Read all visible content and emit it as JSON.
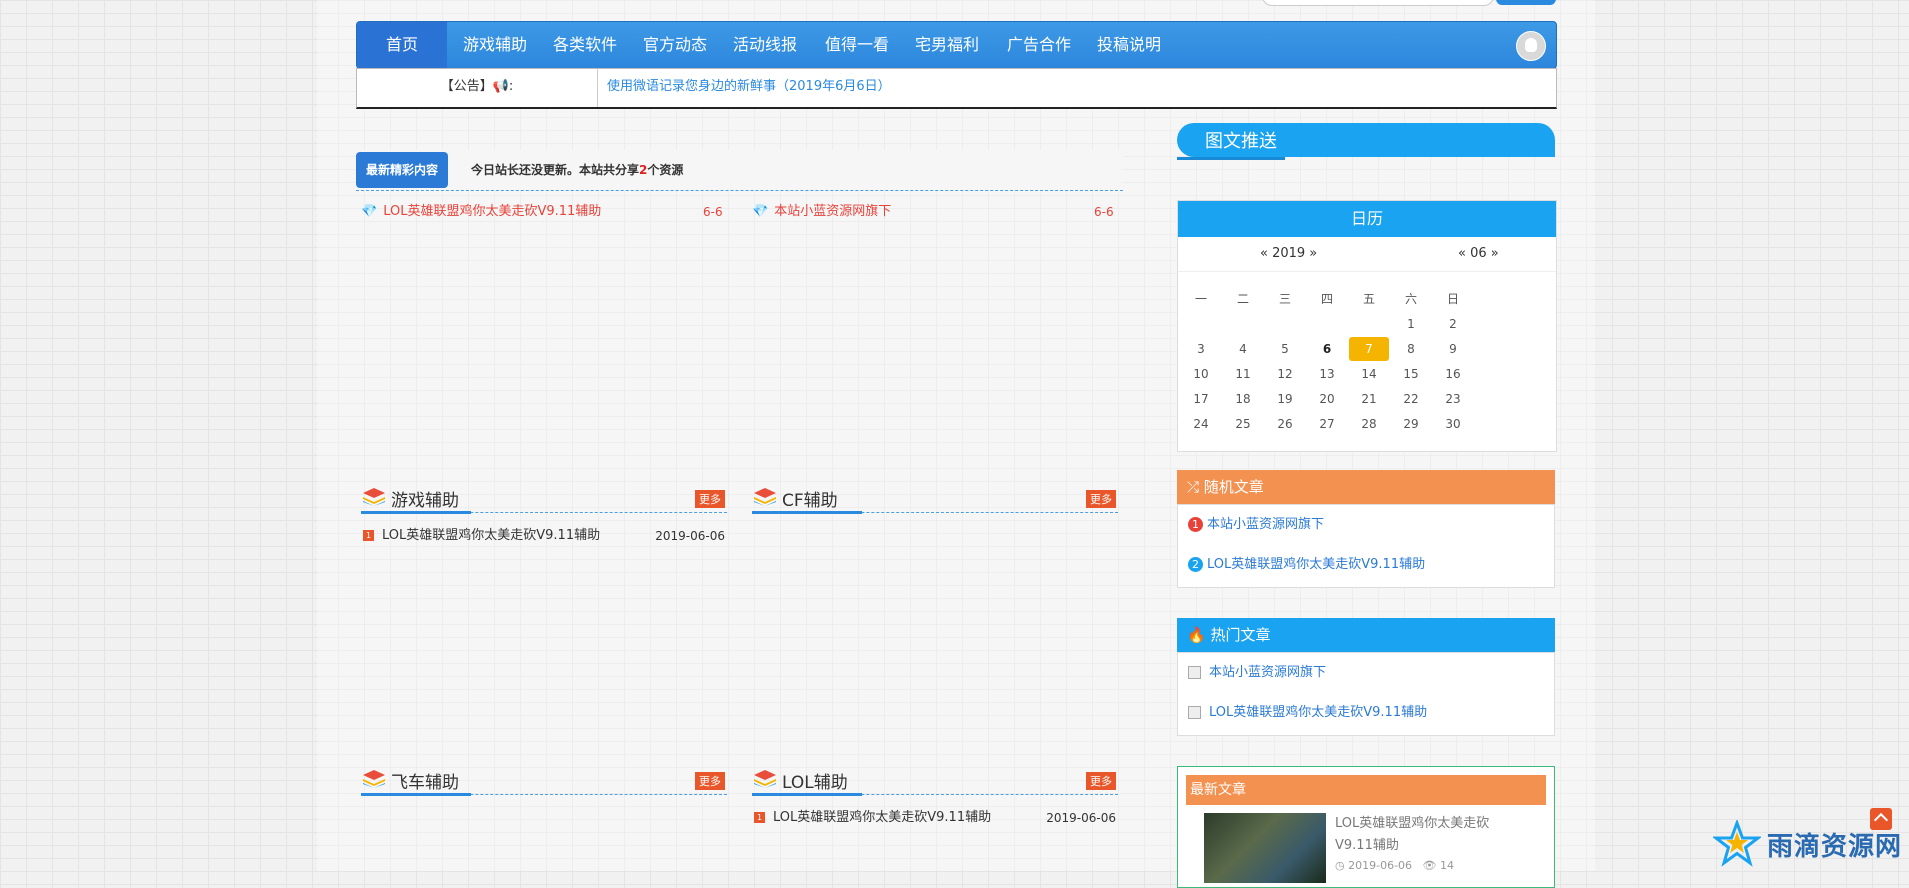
{
  "nav": {
    "items": [
      "首页",
      "游戏辅助",
      "各类软件",
      "官方动态",
      "活动线报",
      "值得一看",
      "宅男福利",
      "广告合作",
      "投稿说明"
    ]
  },
  "notice": {
    "label": "【公告】📢:",
    "text": "使用微语记录您身边的新鲜事（2019年6月6日）"
  },
  "latest": {
    "badge": "最新精彩内容",
    "info_prefix": "今日站长还没更新。本站共分享",
    "count": "2",
    "info_suffix": "个资源",
    "items": [
      {
        "title": "LOL英雄联盟鸡你太美走砍V9.11辅助",
        "date": "6-6"
      },
      {
        "title": "本站小蓝资源网旗下",
        "date": "6-6"
      }
    ]
  },
  "categories": [
    {
      "title": "游戏辅助",
      "more": "更多",
      "rows": [
        {
          "num": "1",
          "title": "LOL英雄联盟鸡你太美走砍V9.11辅助",
          "date": "2019-06-06"
        }
      ]
    },
    {
      "title": "CF辅助",
      "more": "更多",
      "rows": []
    },
    {
      "title": "飞车辅助",
      "more": "更多",
      "rows": []
    },
    {
      "title": "LOL辅助",
      "more": "更多",
      "rows": [
        {
          "num": "1",
          "title": "LOL英雄联盟鸡你太美走砍V9.11辅助",
          "date": "2019-06-06"
        }
      ]
    }
  ],
  "sidebar": {
    "tuwen_title": "图文推送",
    "calendar": {
      "title": "日历",
      "year_nav": "« 2019 »",
      "month_nav": "« 06 »",
      "weekdays": [
        "一",
        "二",
        "三",
        "四",
        "五",
        "六",
        "日"
      ],
      "weeks": [
        [
          "",
          "",
          "",
          "",
          "",
          "1",
          "2"
        ],
        [
          "3",
          "4",
          "5",
          "6",
          "7",
          "8",
          "9"
        ],
        [
          "10",
          "11",
          "12",
          "13",
          "14",
          "15",
          "16"
        ],
        [
          "17",
          "18",
          "19",
          "20",
          "21",
          "22",
          "23"
        ],
        [
          "24",
          "25",
          "26",
          "27",
          "28",
          "29",
          "30"
        ]
      ],
      "today": "7",
      "highlight": "6"
    },
    "random": {
      "title": "随机文章",
      "items": [
        {
          "badge": "1",
          "title": "本站小蓝资源网旗下"
        },
        {
          "badge": "2",
          "title": "LOL英雄联盟鸡你太美走砍V9.11辅助"
        }
      ]
    },
    "hot": {
      "title": "热门文章",
      "items": [
        "本站小蓝资源网旗下",
        "LOL英雄联盟鸡你太美走砍V9.11辅助"
      ]
    },
    "newest": {
      "title": "最新文章",
      "item_title": "LOL英雄联盟鸡你太美走砍V9.11辅助",
      "date": "2019-06-06",
      "views": "14"
    }
  },
  "watermark": "雨滴资源网",
  "colors": {
    "primary": "#2a8ae0",
    "sky": "#1aa3f0",
    "orange": "#f39150",
    "red": "#e8423a",
    "today": "#f5b400"
  }
}
